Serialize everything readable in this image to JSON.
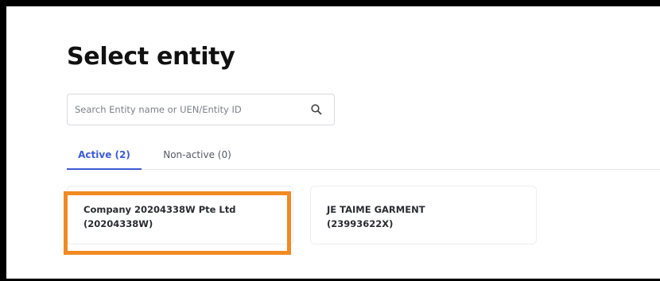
{
  "page": {
    "title": "Select entity"
  },
  "search": {
    "placeholder": "Search Entity name or UEN/Entity ID",
    "value": "",
    "icon": "search-icon"
  },
  "tabs": [
    {
      "label": "Active (2)",
      "active": true
    },
    {
      "label": "Non-active (0)",
      "active": false
    }
  ],
  "entities": [
    {
      "name": "Company 20204338W Pte Ltd",
      "uen": "(20204338W)",
      "highlighted": true
    },
    {
      "name": "JE TAIME GARMENT",
      "uen": "(23993622X)",
      "highlighted": false
    }
  ],
  "colors": {
    "accent": "#3c5bd6",
    "highlight": "#f28a22",
    "frame": "#000000"
  }
}
